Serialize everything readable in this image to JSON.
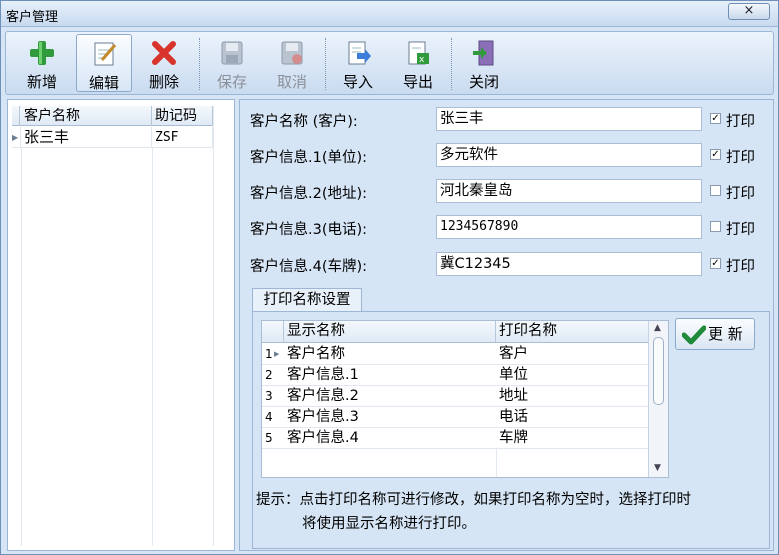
{
  "window": {
    "title": "客户管理",
    "close_glyph": "×"
  },
  "toolbar": {
    "buttons": [
      {
        "label": "新增",
        "icon": "add-icon"
      },
      {
        "label": "编辑",
        "icon": "edit-icon"
      },
      {
        "label": "删除",
        "icon": "delete-icon"
      },
      {
        "label": "保存",
        "icon": "save-icon"
      },
      {
        "label": "取消",
        "icon": "cancel-icon"
      },
      {
        "label": "导入",
        "icon": "import-icon"
      },
      {
        "label": "导出",
        "icon": "export-icon"
      },
      {
        "label": "关闭",
        "icon": "close-door-icon"
      }
    ]
  },
  "customer_list": {
    "headers": [
      "客户名称",
      "助记码"
    ],
    "rows": [
      {
        "name": "张三丰",
        "code": "ZSF"
      }
    ]
  },
  "form": {
    "fields": [
      {
        "label": "客户名称 (客户):",
        "value": "张三丰",
        "print_label": "打印",
        "print": true
      },
      {
        "label": "客户信息.1(单位):",
        "value": "多元软件",
        "print_label": "打印",
        "print": true
      },
      {
        "label": "客户信息.2(地址):",
        "value": "河北秦皇岛",
        "print_label": "打印",
        "print": false
      },
      {
        "label": "客户信息.3(电话):",
        "value": "1234567890",
        "print_label": "打印",
        "print": false
      },
      {
        "label": "客户信息.4(车牌):",
        "value": "冀C12345",
        "print_label": "打印",
        "print": true
      }
    ]
  },
  "print_settings": {
    "tab_label": "打印名称设置",
    "headers": [
      "显示名称",
      "打印名称"
    ],
    "rows": [
      {
        "num": "1",
        "display": "客户名称",
        "print": "客户"
      },
      {
        "num": "2",
        "display": "客户信息.1",
        "print": "单位"
      },
      {
        "num": "3",
        "display": "客户信息.2",
        "print": "地址"
      },
      {
        "num": "4",
        "display": "客户信息.3",
        "print": "电话"
      },
      {
        "num": "5",
        "display": "客户信息.4",
        "print": "车牌"
      }
    ],
    "update_label": "更 新",
    "hint_line1": "提示：点击打印名称可进行修改，如果打印名称为空时，选择打印时",
    "hint_line2": "将使用显示名称进行打印。"
  },
  "colors": {
    "accent": "#1f8a3a",
    "delete": "#d9342b",
    "background": "#d6e5f5"
  }
}
